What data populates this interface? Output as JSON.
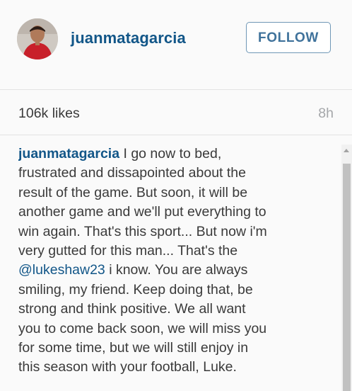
{
  "post": {
    "username": "juanmatagarcia",
    "follow_label": "FOLLOW",
    "likes": "106k likes",
    "time_ago": "8h"
  },
  "caption": {
    "author": "juanmatagarcia",
    "lines": [
      " I go now to bed,",
      "frustrated and dissapointed about the",
      "result of the game. But soon, it will be",
      "another game and we'll put everything to",
      "win again. That's this sport... But now i'm",
      "very gutted for this man... That's the",
      " i know. You are always",
      "smiling, my friend. Keep doing that, be",
      "strong and think positive. We all want",
      "you to come back soon, we will miss you",
      "for some time, but we will still enjoy in",
      "this season with your football, Luke."
    ],
    "mention": "@lukeshaw23"
  },
  "colors": {
    "link": "#125688",
    "follow_text": "#3f729b",
    "follow_border": "#6f97b6",
    "text": "#3a3a3a",
    "muted": "#a5a7aa",
    "background": "#fafafa"
  },
  "icons": {
    "scroll_up": "triangle-up"
  }
}
